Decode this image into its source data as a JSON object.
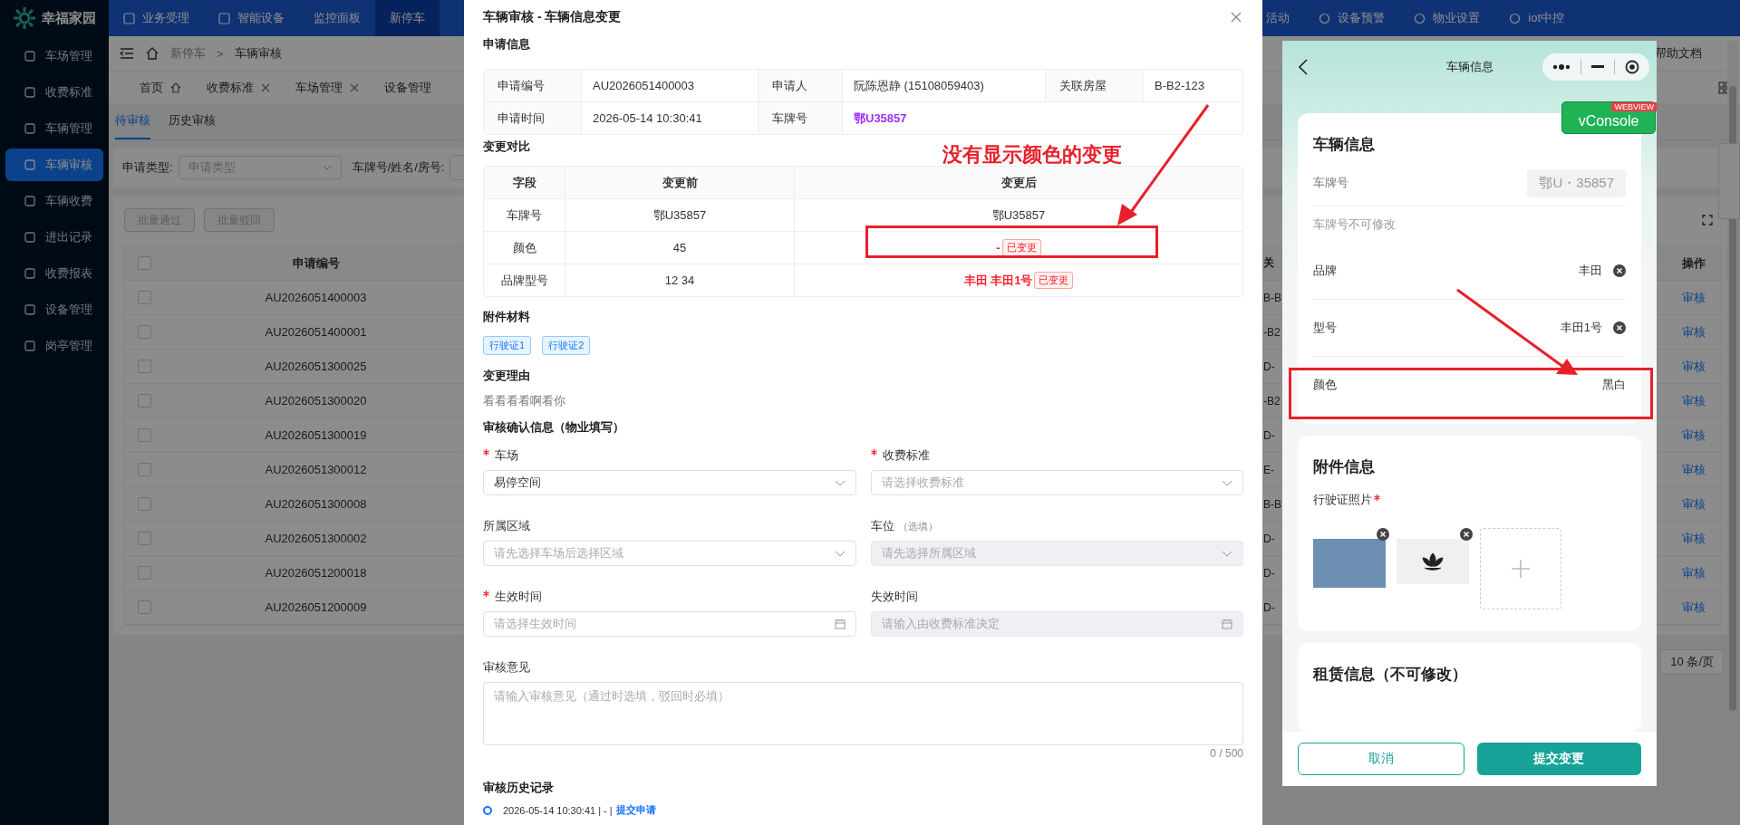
{
  "app": {
    "logo": "幸福家园"
  },
  "top_nav": {
    "items": [
      {
        "label": "业务受理",
        "selected": false
      },
      {
        "label": "智能设备",
        "selected": false
      },
      {
        "label": "监控面板",
        "selected": false
      },
      {
        "label": "新停车",
        "selected": true
      }
    ],
    "right_items": [
      {
        "label": "活动"
      },
      {
        "label": "设备预警"
      },
      {
        "label": "物业设置"
      },
      {
        "label": "iot中控"
      }
    ]
  },
  "sidebar": {
    "items": [
      {
        "label": "车场管理",
        "selected": false
      },
      {
        "label": "收费标准",
        "selected": false
      },
      {
        "label": "车辆管理",
        "selected": false
      },
      {
        "label": "车辆审核",
        "selected": true
      },
      {
        "label": "车辆收费",
        "selected": false
      },
      {
        "label": "进出记录",
        "selected": false
      },
      {
        "label": "收费报表",
        "selected": false
      },
      {
        "label": "设备管理",
        "selected": false
      },
      {
        "label": "岗亭管理",
        "selected": false
      }
    ]
  },
  "breadcrumb": {
    "items": [
      "新停车",
      "车辆审核"
    ],
    "separator": ">"
  },
  "help_link": "帮助文档",
  "page_tabs": [
    {
      "label": "首页",
      "kind": "home"
    },
    {
      "label": "收费标准",
      "kind": "closable"
    },
    {
      "label": "车场管理",
      "kind": "closable"
    },
    {
      "label": "设备管理",
      "kind": "plain"
    }
  ],
  "content_tabs": [
    {
      "label": "待审核",
      "selected": true
    },
    {
      "label": "历史审核",
      "selected": false
    }
  ],
  "filter": {
    "type_label": "申请类型:",
    "type_placeholder": "申请类型",
    "keyword_label": "车牌号/姓名/房号:"
  },
  "batch_buttons": [
    {
      "label": "批量通过",
      "disabled": true
    },
    {
      "label": "批量驳回",
      "disabled": true
    }
  ],
  "table": {
    "all_checked": false,
    "columns": [
      "申请编号",
      "关",
      "操作"
    ],
    "rows": [
      {
        "id": "AU2026051400003",
        "column_3": "B-B",
        "action": "审核",
        "checked": false
      },
      {
        "id": "AU2026051400001",
        "column_3": "-B2",
        "action": "审核",
        "checked": false
      },
      {
        "id": "AU2026051300025",
        "column_3": "D-",
        "action": "审核",
        "checked": false
      },
      {
        "id": "AU2026051300020",
        "column_3": "-B2",
        "action": "审核",
        "checked": false
      },
      {
        "id": "AU2026051300019",
        "column_3": "D-",
        "action": "审核",
        "checked": false
      },
      {
        "id": "AU2026051300012",
        "column_3": "E-",
        "action": "审核",
        "checked": false
      },
      {
        "id": "AU2026051300008",
        "column_3": "B-B",
        "action": "审核",
        "checked": false
      },
      {
        "id": "AU2026051300002",
        "column_3": "D-",
        "action": "审核",
        "checked": false
      },
      {
        "id": "AU2026051200018",
        "column_3": "D-",
        "action": "审核",
        "checked": false
      },
      {
        "id": "AU2026051200009",
        "column_3": "D-",
        "action": "审核",
        "checked": false
      }
    ]
  },
  "pagination": {
    "page_size": "10 条/页"
  },
  "modal": {
    "title": "车辆审核 - 车辆信息变更",
    "info_title": "申请信息",
    "info": [
      [
        {
          "label": "申请编号",
          "value": "AU2026051400003",
          "kind": "plain"
        },
        {
          "label": "申请人",
          "value": "阮陈恩静 (15108059403)",
          "kind": "plain"
        },
        {
          "label": "关联房屋",
          "value": "B-B2-123",
          "kind": "plain"
        }
      ],
      [
        {
          "label": "申请时间",
          "value": "2026-05-14 10:30:41",
          "kind": "plain"
        },
        {
          "label": "车牌号",
          "value": "鄂U35857",
          "kind": "plate"
        }
      ]
    ],
    "compare_title": "变更对比",
    "compare_columns": [
      "字段",
      "变更前",
      "变更后"
    ],
    "compare_rows": [
      {
        "field": "车牌号",
        "before": "鄂U35857",
        "after": "鄂U35857",
        "changed": false
      },
      {
        "field": "颜色",
        "before": "45",
        "after": "-",
        "changed": true,
        "tag": "已变更"
      },
      {
        "field": "品牌型号",
        "before": "12 34",
        "after": "丰田 丰田1号",
        "changed": true,
        "tag": "已变更"
      }
    ],
    "attachments_title": "附件材料",
    "attachments": [
      "行驶证1",
      "行驶证2"
    ],
    "reason_title": "变更理由",
    "reason": "看看看看啊看你",
    "form_title": "审核确认信息（物业填写）",
    "form": [
      {
        "label": "车场",
        "required": true,
        "kind": "select",
        "value": "易停空间",
        "disabled": false
      },
      {
        "label": "收费标准",
        "required": true,
        "kind": "select",
        "placeholder": "请选择收费标准",
        "disabled": false
      },
      {
        "label": "所属区域",
        "required": false,
        "kind": "select",
        "placeholder": "请先选择车场后选择区域",
        "disabled": false
      },
      {
        "label": "车位",
        "note": "（选填）",
        "required": false,
        "kind": "select",
        "placeholder": "请先选择所属区域",
        "disabled": true
      },
      {
        "label": "生效时间",
        "required": true,
        "kind": "date",
        "placeholder": "请选择生效时间",
        "disabled": false
      },
      {
        "label": "失效时间",
        "required": false,
        "kind": "date",
        "placeholder": "请输入由收费标准决定",
        "disabled": true
      },
      {
        "label": "审核意见",
        "required": false,
        "kind": "textarea",
        "placeholder": "请输入审核意见（通过时选填，驳回时必填）",
        "counter": "0 / 500"
      }
    ],
    "history_title": "审核历史记录",
    "history": [
      {
        "meta": "2026-05-14 10:30:41 | - |",
        "action": "提交申请"
      }
    ]
  },
  "annotation": {
    "text": "没有显示颜色的变更"
  },
  "phone": {
    "title": "车辆信息",
    "vconsole": "vConsole",
    "ribbon": "WEBVIEW",
    "vehicle_card": {
      "title": "车辆信息",
      "plate_label": "车牌号",
      "plate_value": "鄂U・35857",
      "plate_hint": "车牌号不可修改",
      "fields": [
        {
          "label": "品牌",
          "value": "丰田",
          "clearable": true
        },
        {
          "label": "型号",
          "value": "丰田1号",
          "clearable": true
        },
        {
          "label": "颜色",
          "value": "黑白",
          "clearable": false
        }
      ]
    },
    "attachment_card": {
      "title": "附件信息",
      "label": "行驶证照片",
      "required": true,
      "photos": [
        {
          "kind": "photo"
        },
        {
          "kind": "lotus"
        }
      ]
    },
    "rental_card": {
      "title": "租赁信息（不可修改）"
    },
    "buttons": [
      {
        "label": "取消",
        "kind": "outline"
      },
      {
        "label": "提交变更",
        "kind": "primary"
      }
    ]
  }
}
